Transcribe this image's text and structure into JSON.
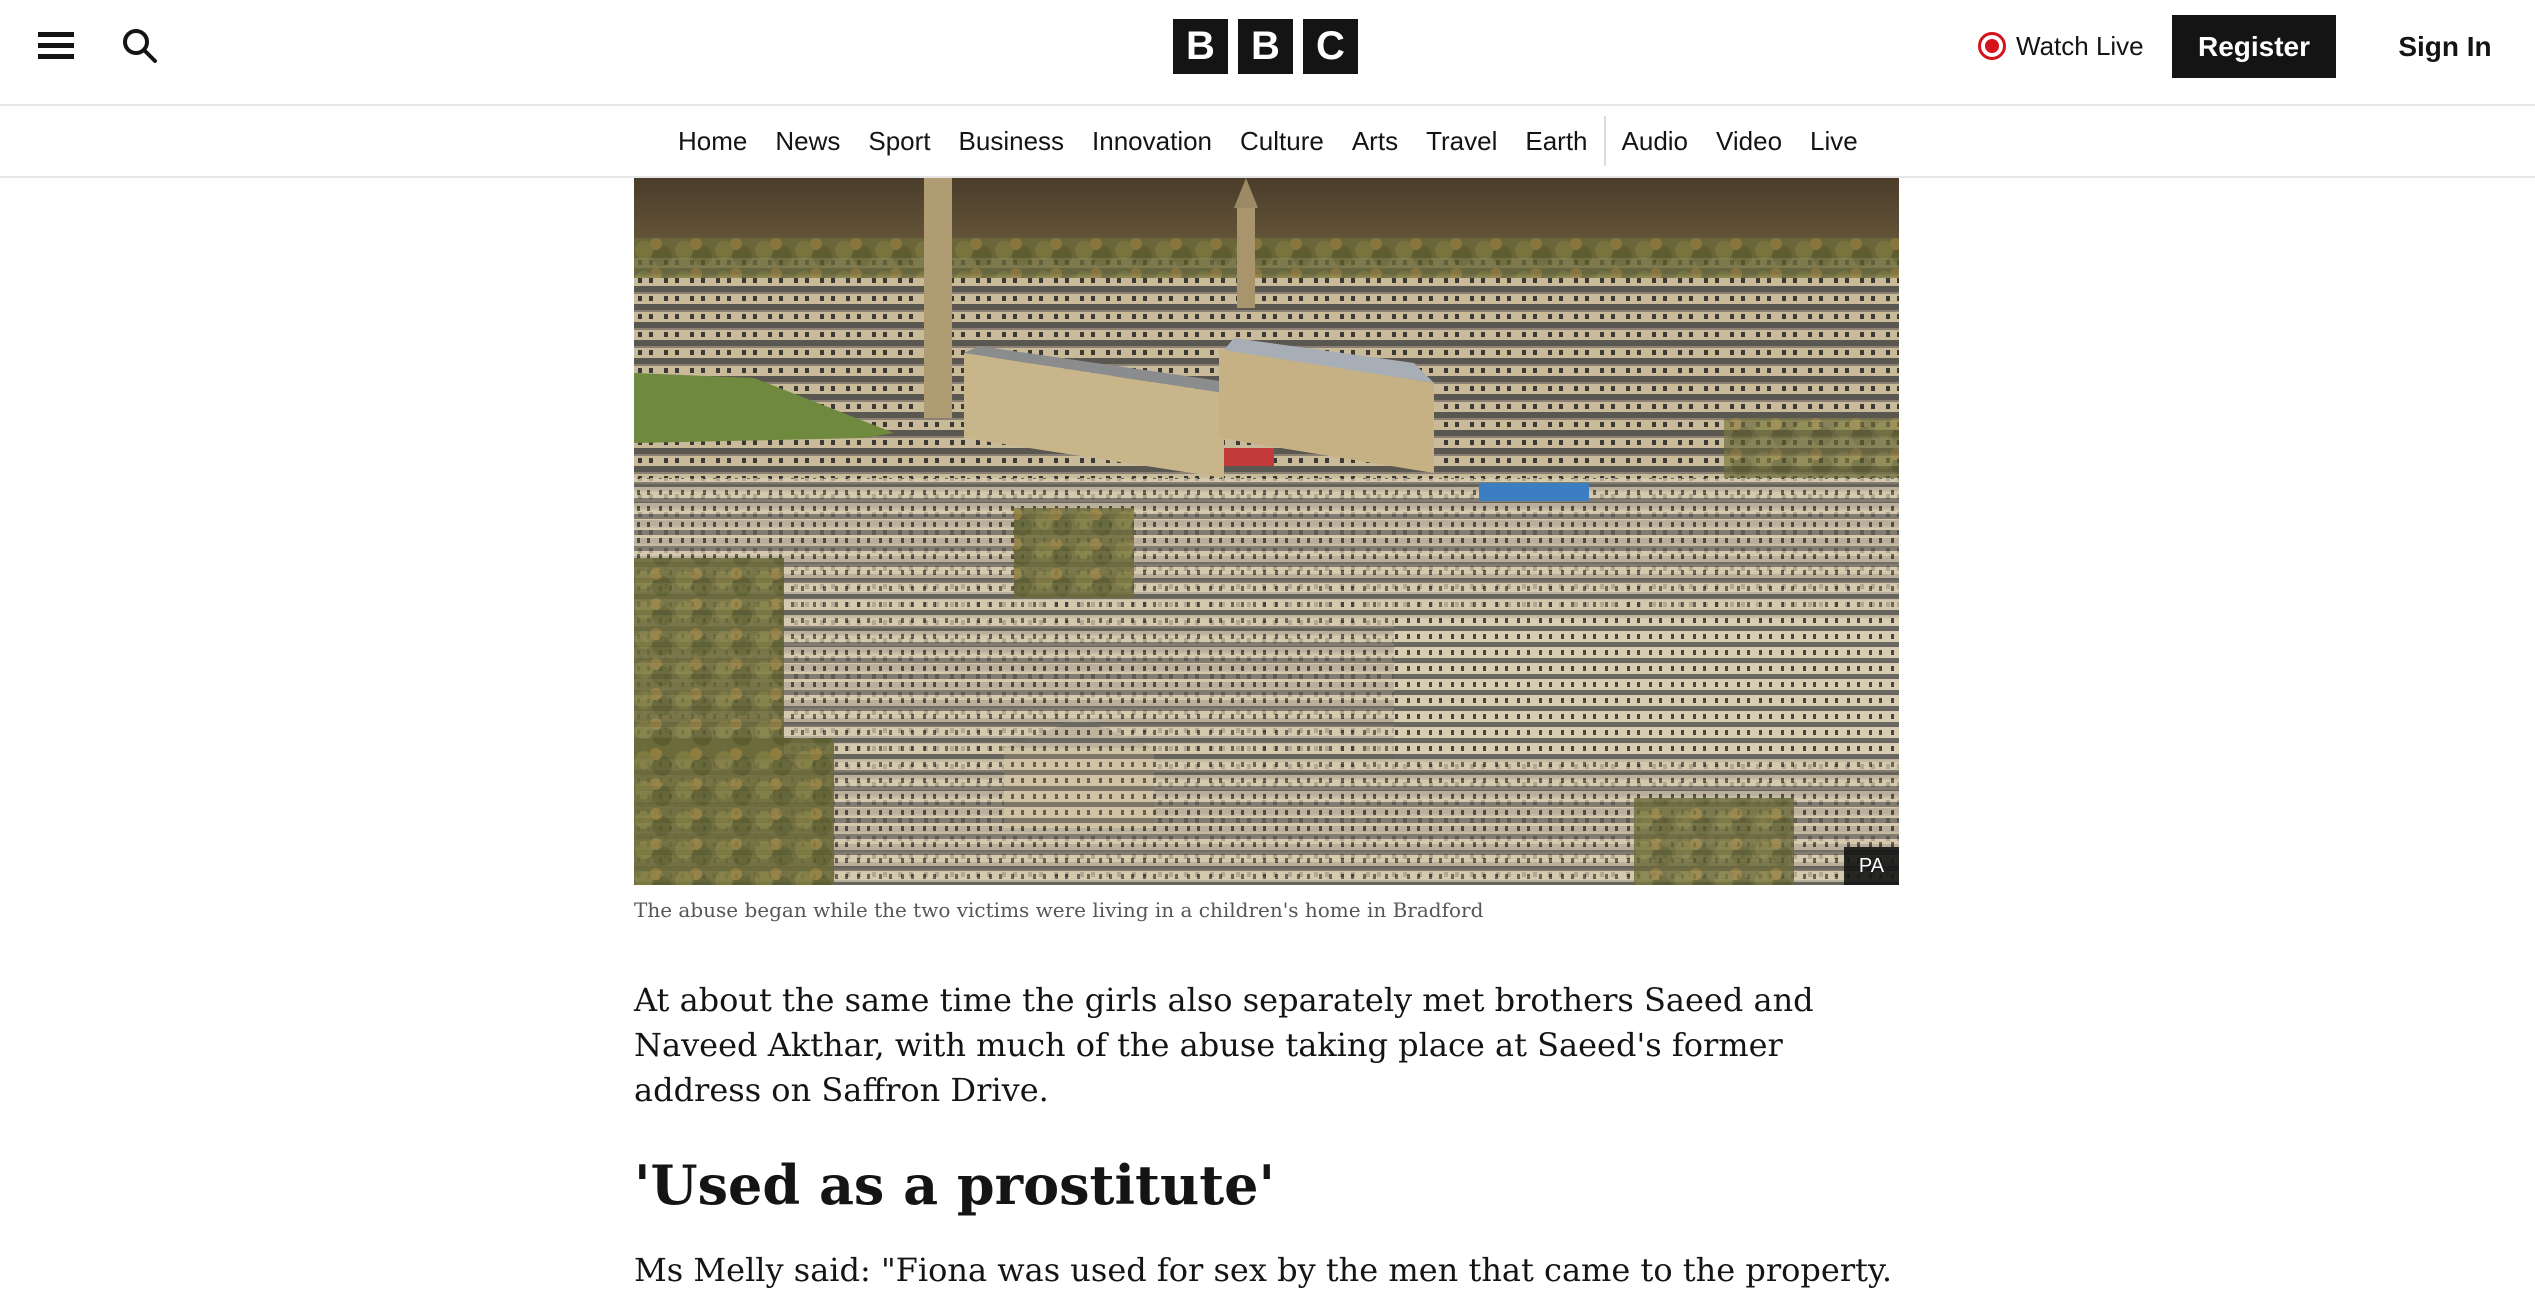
{
  "header": {
    "logo_letters": [
      "B",
      "B",
      "C"
    ],
    "watch_live": "Watch Live",
    "register": "Register",
    "sign_in": "Sign In",
    "icons": {
      "menu": "hamburger-menu-icon",
      "search": "search-icon",
      "live": "live-dot-icon"
    },
    "accent_color": "#d4131a"
  },
  "nav": {
    "items": [
      "Home",
      "News",
      "Sport",
      "Business",
      "Innovation",
      "Culture",
      "Arts",
      "Travel",
      "Earth",
      "Audio",
      "Video",
      "Live"
    ]
  },
  "article": {
    "image_credit": "PA",
    "caption": "The abuse began while the two victims were living in a children's home in Bradford",
    "paragraph_1": "At about the same time the girls also separately met brothers Saeed and Naveed Akthar, with much of the abuse taking place at Saeed's former address on Saffron Drive.",
    "subheading": "'Used as a prostitute'",
    "paragraph_2": "Ms Melly said: \"Fiona was used for sex by the men that came to the property."
  }
}
